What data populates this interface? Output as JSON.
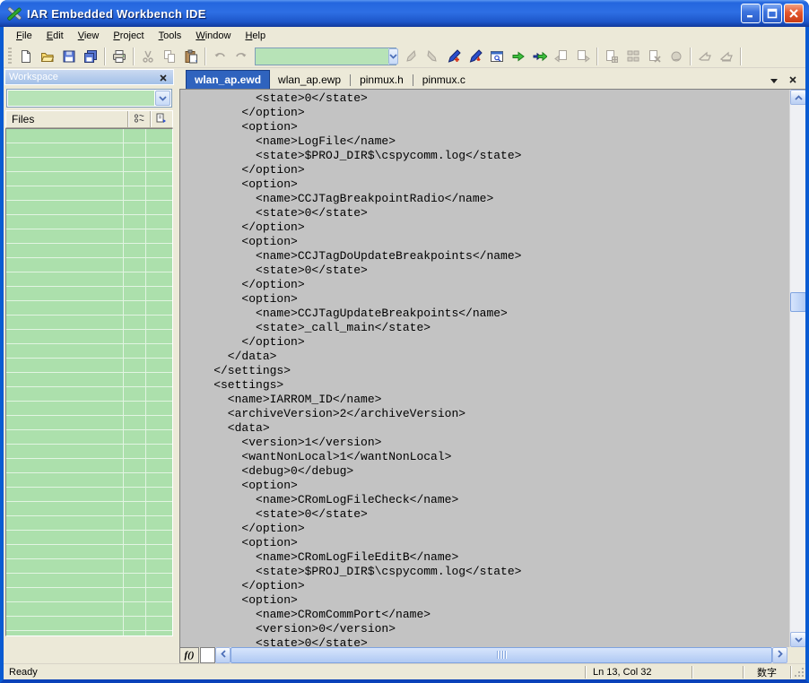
{
  "title_bar": {
    "title": "IAR Embedded Workbench IDE"
  },
  "menu_bar": {
    "items": [
      {
        "key": "F",
        "rest": "ile"
      },
      {
        "key": "E",
        "rest": "dit"
      },
      {
        "key": "V",
        "rest": "iew"
      },
      {
        "key": "P",
        "rest": "roject"
      },
      {
        "key": "T",
        "rest": "ools"
      },
      {
        "key": "W",
        "rest": "indow"
      },
      {
        "key": "H",
        "rest": "elp"
      }
    ]
  },
  "toolbar": {
    "find_combo": {
      "value": ""
    },
    "button_icons": [
      "new-document",
      "open-file",
      "save",
      "save-all",
      "print",
      "cut",
      "copy",
      "paste",
      "undo",
      "redo",
      "find-previous",
      "find-next",
      "toggle-bookmark",
      "go-to-bookmark",
      "find-in-files",
      "go",
      "go-with-arguments",
      "previous-statement",
      "next-statement",
      "make",
      "batch-build",
      "stop-build",
      "toggle-breakpoint",
      "download-and-debug",
      "debug-without-downloading"
    ]
  },
  "workspace": {
    "caption": "Workspace",
    "combo_value": "",
    "files_column_header": "Files"
  },
  "editor": {
    "tabs": [
      {
        "label": "wlan_ap.ewd",
        "active": true
      },
      {
        "label": "wlan_ap.ewp",
        "active": false
      },
      {
        "label": "pinmux.h",
        "active": false
      },
      {
        "label": "pinmux.c",
        "active": false
      }
    ],
    "function_button_label": "f()",
    "lines": [
      "          <state>0</state>",
      "        </option>",
      "        <option>",
      "          <name>LogFile</name>",
      "          <state>$PROJ_DIR$\\cspycomm.log</state>",
      "        </option>",
      "        <option>",
      "          <name>CCJTagBreakpointRadio</name>",
      "          <state>0</state>",
      "        </option>",
      "        <option>",
      "          <name>CCJTagDoUpdateBreakpoints</name>",
      "          <state>0</state>",
      "        </option>",
      "        <option>",
      "          <name>CCJTagUpdateBreakpoints</name>",
      "          <state>_call_main</state>",
      "        </option>",
      "      </data>",
      "    </settings>",
      "    <settings>",
      "      <name>IARROM_ID</name>",
      "      <archiveVersion>2</archiveVersion>",
      "      <data>",
      "        <version>1</version>",
      "        <wantNonLocal>1</wantNonLocal>",
      "        <debug>0</debug>",
      "        <option>",
      "          <name>CRomLogFileCheck</name>",
      "          <state>0</state>",
      "        </option>",
      "        <option>",
      "          <name>CRomLogFileEditB</name>",
      "          <state>$PROJ_DIR$\\cspycomm.log</state>",
      "        </option>",
      "        <option>",
      "          <name>CRomCommPort</name>",
      "          <version>0</version>",
      "          <state>0</state>"
    ]
  },
  "status_bar": {
    "message": "Ready",
    "cursor_position": "Ln 13, Col 32",
    "input_mode": "数字"
  },
  "colors": {
    "titlebar_blue": "#2366DE",
    "active_tab_blue": "#2F63BE",
    "workspace_green": "#ACE0AC",
    "editor_gray": "#C3C3C3",
    "chrome_beige": "#ECE9D8"
  }
}
